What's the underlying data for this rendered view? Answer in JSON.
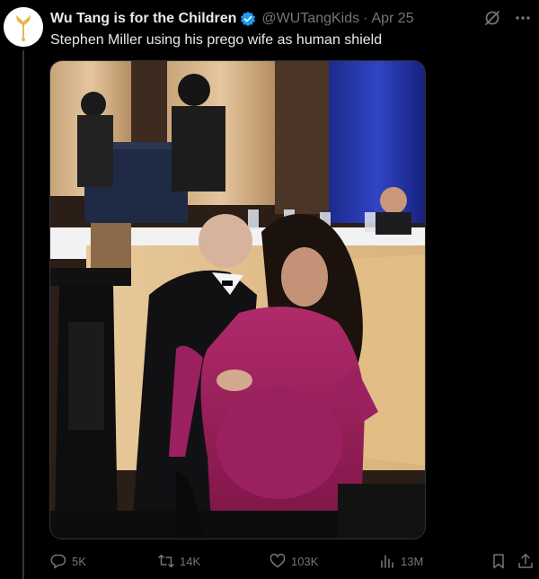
{
  "tweet": {
    "display_name": "Wu Tang is for the Children",
    "handle": "@WUTangKids",
    "separator": "·",
    "date": "Apr 25",
    "text": "Stephen Miller using his prego wife as human shield",
    "verified": true
  },
  "icons": {
    "avatar": "avatar-logo",
    "verified": "verified-badge-icon",
    "grok": "grok-icon",
    "more": "more-icon",
    "reply": "reply-icon",
    "repost": "repost-icon",
    "like": "like-icon",
    "views": "views-icon",
    "bookmark": "bookmark-icon",
    "share": "share-icon"
  },
  "metrics": {
    "replies": "5K",
    "reposts": "14K",
    "likes": "103K",
    "views": "13M"
  },
  "colors": {
    "background": "#000000",
    "text": "#e7e9ea",
    "muted": "#71767b",
    "verified": "#1d9bf0",
    "avatar_gold": "#e8b84a"
  }
}
